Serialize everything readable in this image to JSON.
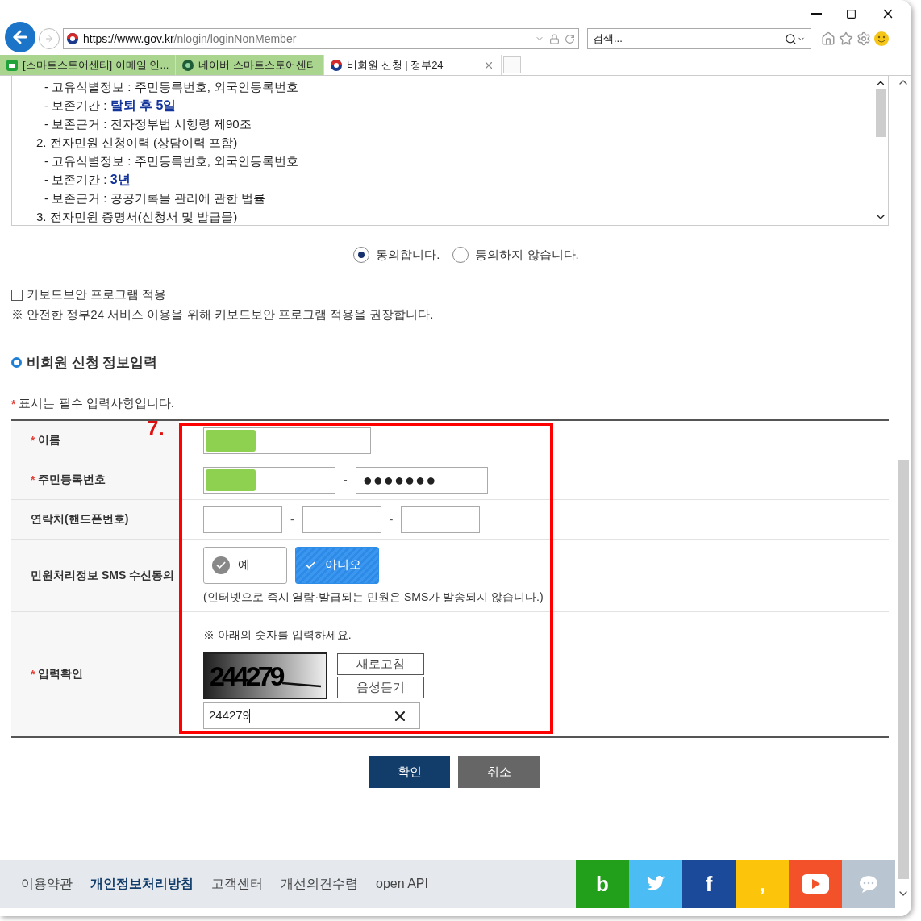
{
  "address": {
    "scheme": "https://",
    "host": "www.gov.kr",
    "path": "/nlogin/loginNonMember"
  },
  "search": {
    "placeholder": "검색..."
  },
  "tabs": [
    {
      "label": "[스마트스토어센터] 이메일 인...",
      "selected": false,
      "kind": "mail"
    },
    {
      "label": "네이버 스마트스토어센터",
      "selected": false,
      "kind": "store"
    },
    {
      "label": "비회원 신청 | 정부24",
      "selected": true,
      "kind": "gov"
    }
  ],
  "notice_lines": [
    {
      "kind": "sub",
      "text": "- 고유식별정보 : 주민등록번호, 외국인등록번호"
    },
    {
      "kind": "sub",
      "text": "- 보존기간 : **탈퇴 후 5일**"
    },
    {
      "kind": "sub",
      "text": "- 보존근거 : 전자정부법 시행령 제90조"
    },
    {
      "kind": "item",
      "text": "2. 전자민원 신청이력 (상담이력 포함)"
    },
    {
      "kind": "sub",
      "text": "- 고유식별정보 : 주민등록번호, 외국인등록번호"
    },
    {
      "kind": "sub",
      "text": "- 보존기간 : **3년**"
    },
    {
      "kind": "sub",
      "text": "- 보존근거 : 공공기록물 관리에 관한 법률"
    },
    {
      "kind": "item",
      "text": "3. 전자민원 증명서(신청서 및 발급물)"
    }
  ],
  "consent": [
    {
      "label": "동의합니다.",
      "selected": true
    },
    {
      "label": "동의하지 않습니다.",
      "selected": false
    }
  ],
  "keyboard_security": {
    "label": "키보드보안 프로그램 적용",
    "checked": false
  },
  "keyboard_note": "※ 안전한 정부24 서비스 이용을 위해 키보드보안 프로그램 적용을 권장합니다.",
  "section_title": "비회원 신청 정보입력",
  "required_mark": "*",
  "required_note": "표시는 필수 입력사항입니다.",
  "annotation": {
    "label": "7."
  },
  "rows": [
    {
      "kind": "name",
      "label": "이름",
      "required": true,
      "redacted": true
    },
    {
      "kind": "rrn",
      "label": "주민등록번호",
      "required": true,
      "redacted": true,
      "separator": "-",
      "masked": "●●●●●●●"
    },
    {
      "kind": "phone",
      "label": "연락처(핸드폰번호)",
      "required": false,
      "separators": [
        "-",
        "-"
      ]
    },
    {
      "kind": "sms",
      "label": "민원처리정보 SMS 수신동의",
      "required": false,
      "options": [
        {
          "label": "예",
          "selected": false
        },
        {
          "label": "아니오",
          "selected": true
        }
      ],
      "note": "(인터넷으로 즉시 열람·발급되는 민원은 SMS가 발송되지 않습니다.)"
    },
    {
      "kind": "captcha",
      "label": "입력확인",
      "required": true,
      "instruction": "※ 아래의 숫자를 입력하세요.",
      "captcha": "244279",
      "buttons": [
        "새로고침",
        "음성듣기"
      ],
      "value": "244279"
    }
  ],
  "actions": [
    {
      "label": "확인",
      "kind": "primary"
    },
    {
      "label": "취소",
      "kind": "secondary"
    }
  ],
  "footer_links": [
    {
      "label": "이용약관",
      "bold": false
    },
    {
      "label": "개인정보처리방침",
      "bold": true
    },
    {
      "label": "고객센터",
      "bold": false
    },
    {
      "label": "개선의견수렴",
      "bold": false
    },
    {
      "label": "open API",
      "bold": false
    }
  ],
  "social": [
    {
      "kind": "glyph",
      "glyph": "b",
      "color": "#23a01b"
    },
    {
      "kind": "bird",
      "color": "#4cbcf5"
    },
    {
      "kind": "glyph",
      "glyph": "f",
      "color": "#1c4a9a"
    },
    {
      "kind": "glyph",
      "glyph": ",",
      "color": "#fcc50b"
    },
    {
      "kind": "play",
      "color": "#f2512a"
    },
    {
      "kind": "chat",
      "color": "#b9c6d2"
    }
  ]
}
